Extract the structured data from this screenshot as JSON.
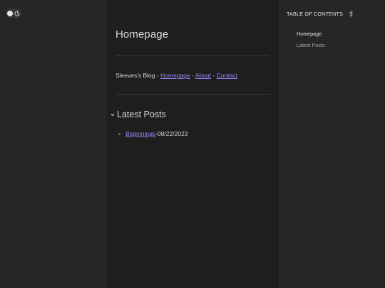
{
  "main": {
    "title": "Homepage",
    "nav": {
      "prefix": "Sleeves's Blog - ",
      "links": [
        "Homepage",
        "About",
        "Contact"
      ],
      "separator": " - "
    },
    "latest_heading": "Latest Posts",
    "posts": [
      {
        "title": "Beginnings",
        "date": "08/22/2023"
      }
    ],
    "post_date_separator": " - "
  },
  "toc": {
    "header": "TABLE OF CONTENTS",
    "items": [
      "Homepage",
      "Latest Posts"
    ]
  },
  "colors": {
    "accent": "#9d82f5",
    "background": "#1e1e1e",
    "sidebar": "#262626"
  },
  "icons": [
    "theme-toggle-knob",
    "moon-icon",
    "chevron-down-icon",
    "bullet-icon",
    "collapse-icon"
  ]
}
